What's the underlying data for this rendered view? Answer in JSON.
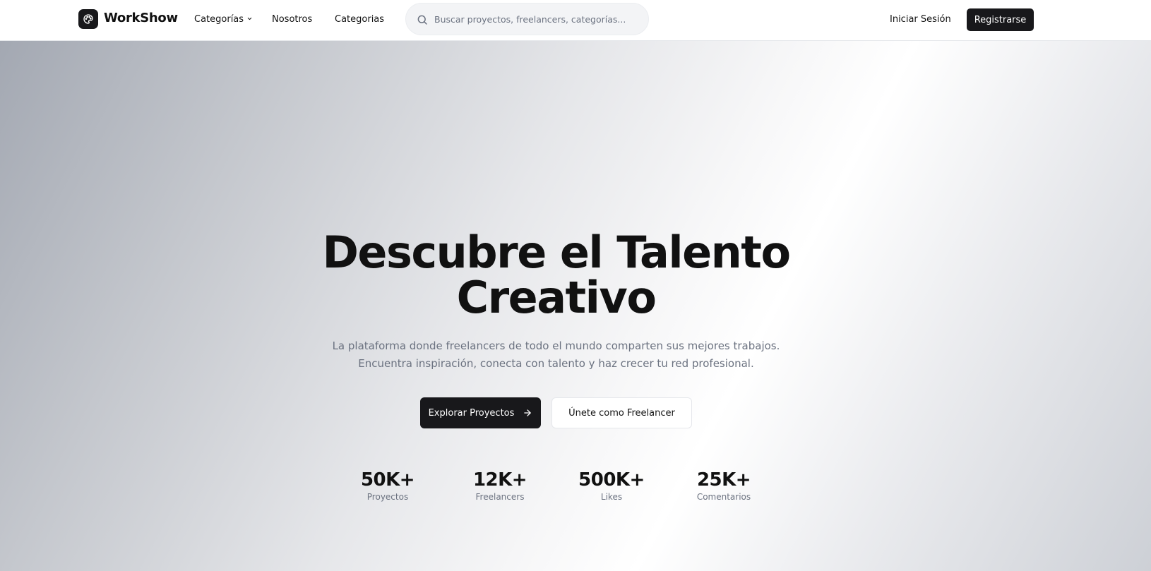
{
  "brand": {
    "name": "WorkShow",
    "logo_icon": "palette-icon"
  },
  "nav": {
    "links": [
      {
        "label": "Categorías",
        "has_dropdown": true
      },
      {
        "label": "Nosotros"
      },
      {
        "label": "Categorias"
      }
    ]
  },
  "search": {
    "placeholder": "Buscar proyectos, freelancers, categorías...",
    "value": ""
  },
  "auth": {
    "login_label": "Iniciar Sesión",
    "register_label": "Registrarse"
  },
  "hero": {
    "title_line1": "Descubre el Talento",
    "title_line2": "Creativo",
    "subtitle_line1": "La plataforma donde freelancers de todo el mundo comparten sus mejores trabajos.",
    "subtitle_line2": "Encuentra inspiración, conecta con talento y haz crecer tu red profesional.",
    "primary_cta": "Explorar Proyectos",
    "secondary_cta": "Únete como Freelancer"
  },
  "stats": [
    {
      "value": "50K+",
      "label": "Proyectos"
    },
    {
      "value": "12K+",
      "label": "Freelancers"
    },
    {
      "value": "500K+",
      "label": "Likes"
    },
    {
      "value": "25K+",
      "label": "Comentarios"
    }
  ],
  "colors": {
    "primary": "#18181b",
    "muted_text": "#6b7280",
    "border": "#e5e7eb"
  }
}
